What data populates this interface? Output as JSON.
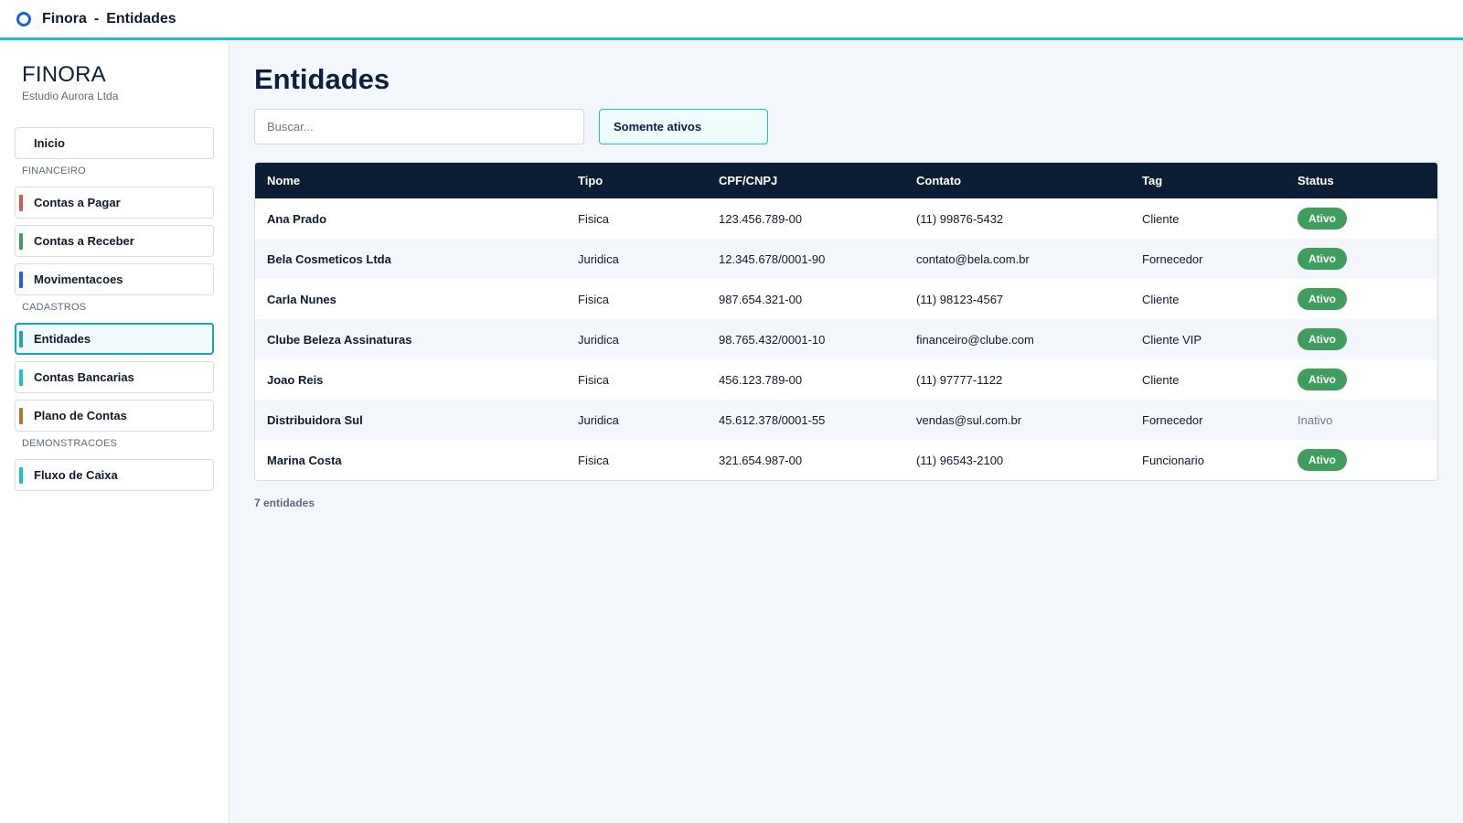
{
  "window": {
    "app": "Finora",
    "separator": "-",
    "page": "Entidades"
  },
  "colors": {
    "accent": "#17c3c4",
    "header_bg": "#0c1e36",
    "active_badge": "#3f9d5e"
  },
  "sidebar": {
    "brand": "FINORA",
    "company": "Estudio Aurora Ltda",
    "home": {
      "label": "Inicio"
    },
    "sections": [
      {
        "title": "FINANCEIRO",
        "items": [
          {
            "label": "Contas a Pagar",
            "color": "#d9534f"
          },
          {
            "label": "Contas a Receber",
            "color": "#3f9d5e"
          },
          {
            "label": "Movimentacoes",
            "color": "#1f5ee6"
          }
        ]
      },
      {
        "title": "CADASTROS",
        "items": [
          {
            "label": "Entidades",
            "color": "#1aa7b0",
            "active": true
          },
          {
            "label": "Contas Bancarias",
            "color": "#17c3c4"
          },
          {
            "label": "Plano de Contas",
            "color": "#b8742a"
          }
        ]
      },
      {
        "title": "DEMONSTRACOES",
        "items": [
          {
            "label": "Fluxo de Caixa",
            "color": "#17c3c4"
          }
        ]
      }
    ]
  },
  "main": {
    "title": "Entidades",
    "search": {
      "placeholder": "Buscar...",
      "value": ""
    },
    "filter_label": "Somente ativos",
    "columns": [
      "Nome",
      "Tipo",
      "CPF/CNPJ",
      "Contato",
      "Tag",
      "Status"
    ],
    "rows": [
      {
        "nome": "Ana Prado",
        "tipo": "Fisica",
        "doc": "123.456.789-00",
        "contato": "(11) 99876-5432",
        "tag": "Cliente",
        "status": "Ativo",
        "active": true
      },
      {
        "nome": "Bela Cosmeticos Ltda",
        "tipo": "Juridica",
        "doc": "12.345.678/0001-90",
        "contato": "contato@bela.com.br",
        "tag": "Fornecedor",
        "status": "Ativo",
        "active": true
      },
      {
        "nome": "Carla Nunes",
        "tipo": "Fisica",
        "doc": "987.654.321-00",
        "contato": "(11) 98123-4567",
        "tag": "Cliente",
        "status": "Ativo",
        "active": true
      },
      {
        "nome": "Clube Beleza Assinaturas",
        "tipo": "Juridica",
        "doc": "98.765.432/0001-10",
        "contato": "financeiro@clube.com",
        "tag": "Cliente VIP",
        "status": "Ativo",
        "active": true
      },
      {
        "nome": "Joao Reis",
        "tipo": "Fisica",
        "doc": "456.123.789-00",
        "contato": "(11) 97777-1122",
        "tag": "Cliente",
        "status": "Ativo",
        "active": true
      },
      {
        "nome": "Distribuidora Sul",
        "tipo": "Juridica",
        "doc": "45.612.378/0001-55",
        "contato": "vendas@sul.com.br",
        "tag": "Fornecedor",
        "status": "Inativo",
        "active": false
      },
      {
        "nome": "Marina Costa",
        "tipo": "Fisica",
        "doc": "321.654.987-00",
        "contato": "(11) 96543-2100",
        "tag": "Funcionario",
        "status": "Ativo",
        "active": true
      }
    ],
    "count_label": "7 entidades"
  }
}
